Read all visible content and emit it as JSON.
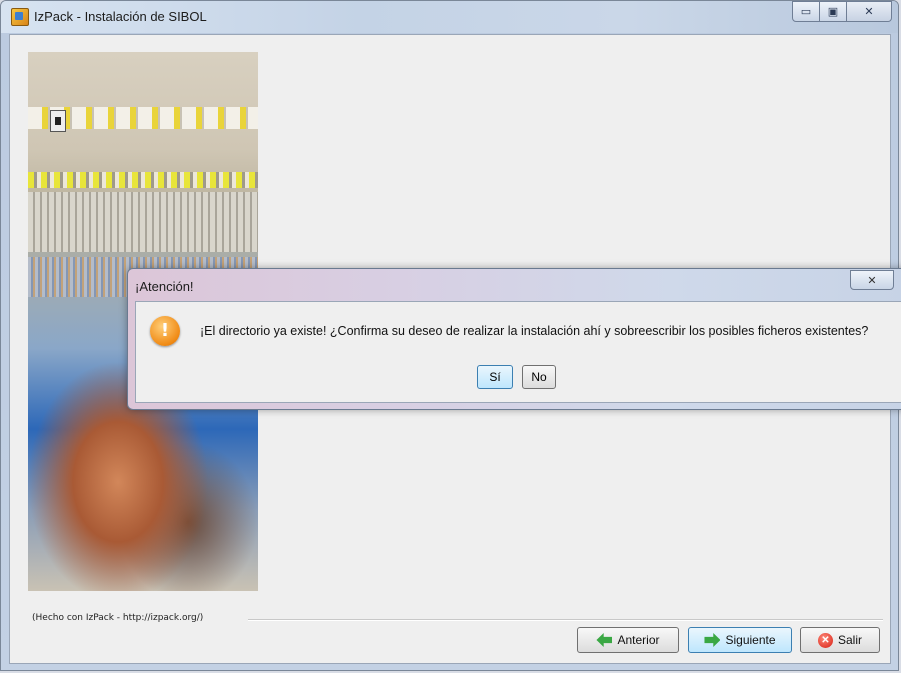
{
  "window": {
    "title": "IzPack - Instalación de  SIBOL",
    "controls": {
      "minimize": "▭",
      "maximize": "▣",
      "close": "✕"
    }
  },
  "footer": {
    "credit": "(Hecho con IzPack - http://izpack.org/)"
  },
  "nav": {
    "back_label": "Anterior",
    "next_label": "Siguiente",
    "exit_label": "Salir",
    "exit_icon_glyph": "✕"
  },
  "dialog": {
    "title": "¡Atención!",
    "close_glyph": "✕",
    "icon_glyph": "!",
    "message": "¡El directorio ya existe! ¿Confirma su deseo de realizar la instalación ahí y sobreescribir los posibles ficheros existentes?",
    "yes_label": "Sí",
    "no_label": "No"
  },
  "colors": {
    "warning": "#f08a14",
    "focus_border": "#3c7fb1",
    "arrow_green": "#3aa844",
    "exit_red": "#d61d12"
  }
}
